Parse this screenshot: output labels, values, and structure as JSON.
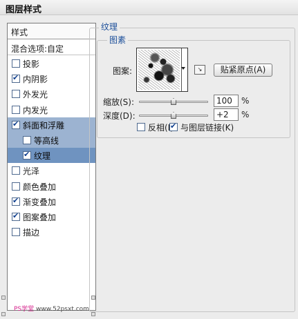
{
  "window": {
    "title": "图层样式"
  },
  "sidebar": {
    "header": "样式",
    "blend_options": "混合选项:自定",
    "items": [
      {
        "label": "投影",
        "checked": false,
        "state": "normal",
        "sub": false
      },
      {
        "label": "内阴影",
        "checked": true,
        "state": "normal",
        "sub": false
      },
      {
        "label": "外发光",
        "checked": false,
        "state": "normal",
        "sub": false
      },
      {
        "label": "内发光",
        "checked": false,
        "state": "normal",
        "sub": false
      },
      {
        "label": "斜面和浮雕",
        "checked": true,
        "state": "selected",
        "sub": false
      },
      {
        "label": "等高线",
        "checked": false,
        "state": "selected",
        "sub": true
      },
      {
        "label": "纹理",
        "checked": true,
        "state": "active",
        "sub": true
      },
      {
        "label": "光泽",
        "checked": false,
        "state": "normal",
        "sub": false
      },
      {
        "label": "颜色叠加",
        "checked": false,
        "state": "normal",
        "sub": false
      },
      {
        "label": "渐变叠加",
        "checked": true,
        "state": "normal",
        "sub": false
      },
      {
        "label": "图案叠加",
        "checked": true,
        "state": "normal",
        "sub": false
      },
      {
        "label": "描边",
        "checked": false,
        "state": "normal",
        "sub": false
      }
    ]
  },
  "panel": {
    "section_title": "纹理",
    "group_title": "图素",
    "pattern_label": "图案:",
    "snap_button": "贴紧原点(A)",
    "scale": {
      "label": "缩放(S):",
      "value": "100",
      "unit": "%",
      "level": 0.5
    },
    "depth": {
      "label": "深度(D):",
      "value": "+2",
      "unit": "%",
      "level": 0.5
    },
    "invert": {
      "label": "反相(I)",
      "checked": false
    },
    "link": {
      "label": "与图层链接(K)",
      "checked": true
    }
  },
  "watermark": {
    "text": "PS学堂",
    "site": "www.52psxt.com"
  },
  "colors": {
    "selected": "#9cb3d1",
    "active": "#6f93c0",
    "legend": "#1c4f9a"
  }
}
